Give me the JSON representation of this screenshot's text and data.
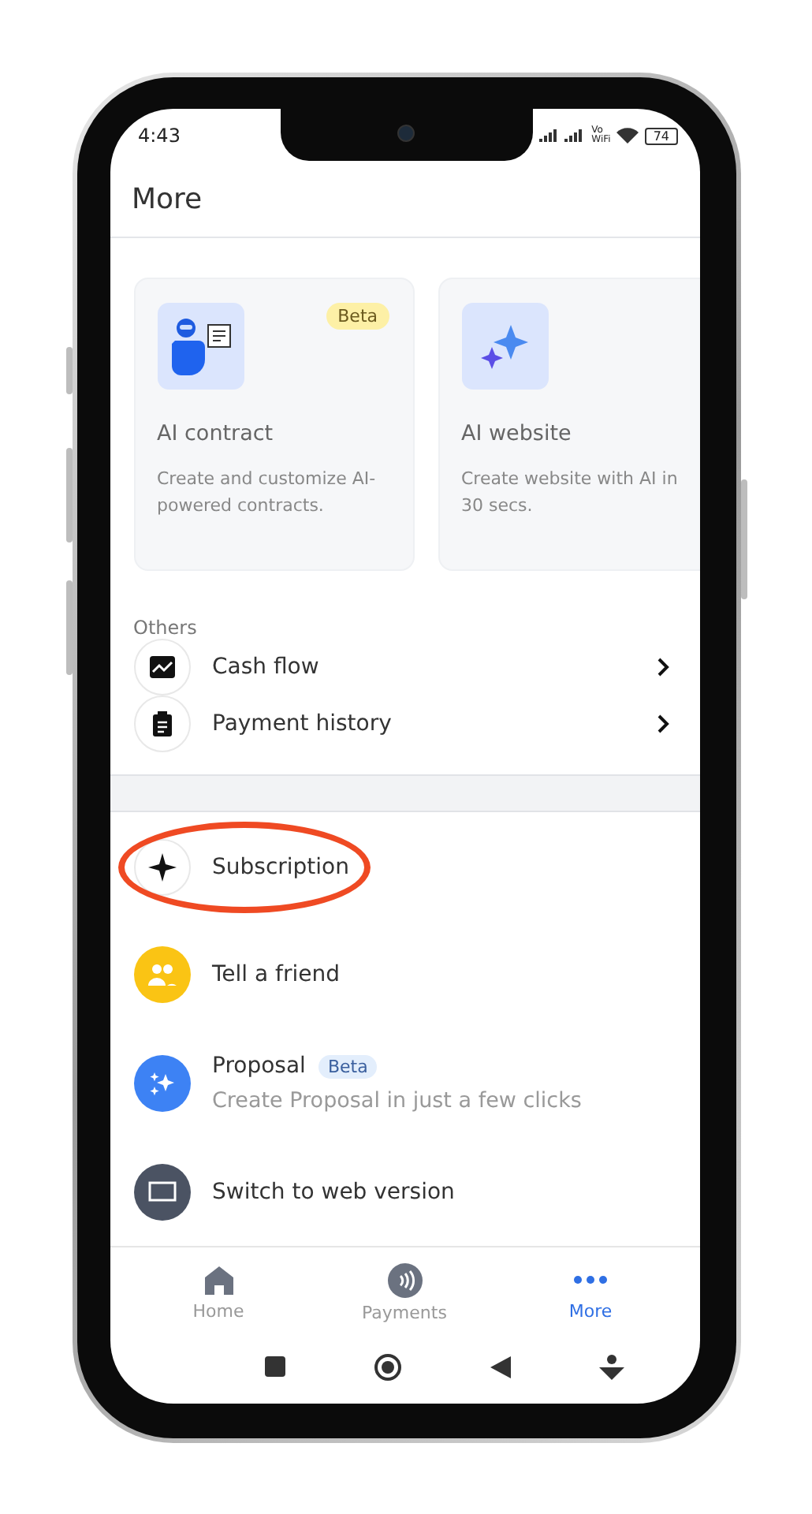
{
  "status_bar": {
    "time": "4:43",
    "vo": "Vo",
    "wifi": "WiFi",
    "battery": "74"
  },
  "header": {
    "title": "More"
  },
  "feature_cards": [
    {
      "kind": "robot",
      "title": "AI contract",
      "description": "Create and customize AI-powered contracts.",
      "badge": "Beta"
    },
    {
      "kind": "sparkle",
      "title": "AI website",
      "description": "Create website with AI in 30 secs."
    }
  ],
  "others": {
    "heading": "Others",
    "items": [
      {
        "kind": "chart",
        "label": "Cash flow"
      },
      {
        "kind": "clipboard",
        "label": "Payment history"
      }
    ]
  },
  "extras": [
    {
      "kind": "star",
      "label": "Subscription",
      "highlighted": true
    },
    {
      "kind": "people",
      "label": "Tell a friend",
      "highlighted": false
    },
    {
      "kind": "sparkles",
      "label": "Proposal",
      "badge": "Beta",
      "subtitle": "Create Proposal in just a few clicks",
      "highlighted": false
    },
    {
      "kind": "monitor",
      "label": "Switch to web version",
      "highlighted": false
    }
  ],
  "tabs": [
    {
      "kind": "home",
      "label": "Home",
      "selected": false
    },
    {
      "kind": "payments",
      "label": "Payments",
      "selected": false
    },
    {
      "kind": "more",
      "label": "More",
      "selected": true
    }
  ]
}
